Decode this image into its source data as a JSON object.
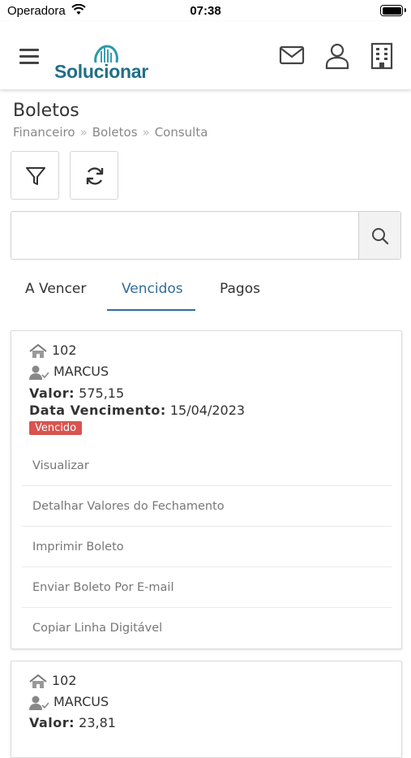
{
  "status_bar": {
    "carrier": "Operadora",
    "time": "07:38"
  },
  "header": {
    "brand": "Solucionar",
    "icons": [
      "menu-icon",
      "mail-icon",
      "user-icon",
      "building-icon"
    ]
  },
  "page": {
    "title": "Boletos",
    "breadcrumb": [
      "Financeiro",
      "Boletos",
      "Consulta"
    ]
  },
  "search": {
    "value": "",
    "placeholder": ""
  },
  "tabs": [
    {
      "label": "A Vencer",
      "active": false
    },
    {
      "label": "Vencidos",
      "active": true
    },
    {
      "label": "Pagos",
      "active": false
    }
  ],
  "cards": [
    {
      "unit": "102",
      "owner": "MARCUS",
      "valor_label": "Valor:",
      "valor": "575,15",
      "vencimento_label": "Data Vencimento:",
      "vencimento": "15/04/2023",
      "status": "Vencido",
      "actions": [
        "Visualizar",
        "Detalhar Valores do Fechamento",
        "Imprimir Boleto",
        "Enviar Boleto Por E-mail",
        "Copiar Linha Digitável"
      ]
    },
    {
      "unit": "102",
      "owner": "MARCUS",
      "valor_label": "Valor:",
      "valor": "23,81"
    }
  ],
  "colors": {
    "brand": "#1f6f87",
    "active_tab": "#2f6d9a",
    "status_badge": "#d9534f"
  }
}
